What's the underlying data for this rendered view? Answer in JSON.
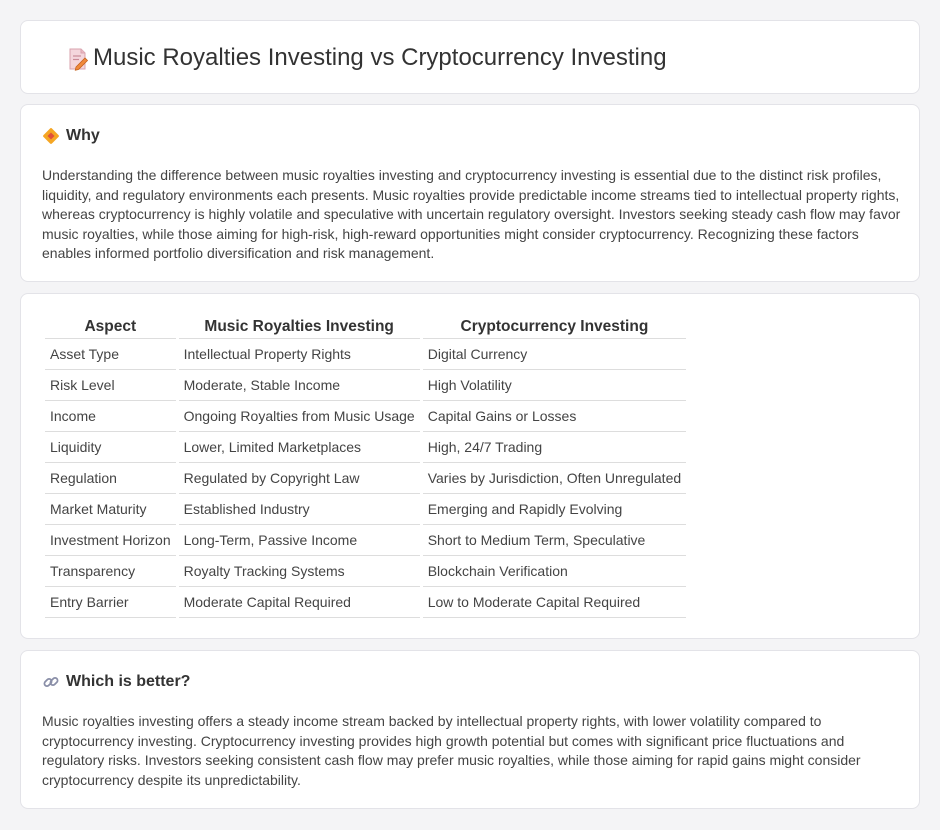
{
  "header": {
    "title": "Music Royalties Investing vs Cryptocurrency Investing",
    "icon": "document-pen-icon"
  },
  "why": {
    "heading": "Why",
    "icon": "diamond-sign-icon",
    "text": "Understanding the difference between music royalties investing and cryptocurrency investing is essential due to the distinct risk profiles, liquidity, and regulatory environments each presents. Music royalties provide predictable income streams tied to intellectual property rights, whereas cryptocurrency is highly volatile and speculative with uncertain regulatory oversight. Investors seeking steady cash flow may favor music royalties, while those aiming for high-risk, high-reward opportunities might consider cryptocurrency. Recognizing these factors enables informed portfolio diversification and risk management."
  },
  "table": {
    "headers": [
      "Aspect",
      "Music Royalties Investing",
      "Cryptocurrency Investing"
    ],
    "rows": [
      [
        "Asset Type",
        "Intellectual Property Rights",
        "Digital Currency"
      ],
      [
        "Risk Level",
        "Moderate, Stable Income",
        "High Volatility"
      ],
      [
        "Income",
        "Ongoing Royalties from Music Usage",
        "Capital Gains or Losses"
      ],
      [
        "Liquidity",
        "Lower, Limited Marketplaces",
        "High, 24/7 Trading"
      ],
      [
        "Regulation",
        "Regulated by Copyright Law",
        "Varies by Jurisdiction, Often Unregulated"
      ],
      [
        "Market Maturity",
        "Established Industry",
        "Emerging and Rapidly Evolving"
      ],
      [
        "Investment Horizon",
        "Long-Term, Passive Income",
        "Short to Medium Term, Speculative"
      ],
      [
        "Transparency",
        "Royalty Tracking Systems",
        "Blockchain Verification"
      ],
      [
        "Entry Barrier",
        "Moderate Capital Required",
        "Low to Moderate Capital Required"
      ]
    ]
  },
  "better": {
    "heading": "Which is better?",
    "icon": "link-icon",
    "text": "Music royalties investing offers a steady income stream backed by intellectual property rights, with lower volatility compared to cryptocurrency investing. Cryptocurrency investing provides high growth potential but comes with significant price fluctuations and regulatory risks. Investors seeking consistent cash flow may prefer music royalties, while those aiming for rapid gains might consider cryptocurrency despite its unpredictability."
  },
  "colors": {
    "page_bg": "#f4f4f6",
    "card_bg": "#ffffff",
    "icon_orange": "#f5a623",
    "icon_pink": "#e8637a"
  }
}
